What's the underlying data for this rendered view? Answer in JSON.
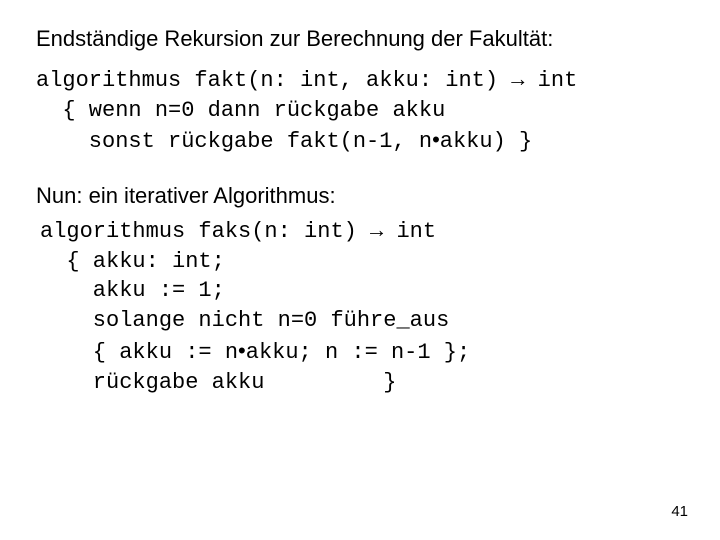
{
  "heading1": "Endständige Rekursion zur Berechnung der Fakultät:",
  "code1_l1": "algorithmus fakt(n: int, akku: int) → int",
  "code1_l2": "  { wenn n=0 dann rückgabe akku",
  "code1_l3_a": "    sonst rückgabe fakt(n-1, n",
  "code1_l3_b": "akku) }",
  "heading2": "Nun: ein iterativer Algorithmus:",
  "code2_l1": "algorithmus faks(n: int) → int",
  "code2_l2": "  { akku: int;",
  "code2_l3": "    akku := 1;",
  "code2_l4": "    solange nicht n=0 führe_aus",
  "code2_l5_a": "    { akku := n",
  "code2_l5_b": "akku; n := n-1 };",
  "code2_l6": "    rückgabe akku         }",
  "dot": "•",
  "pagenum": "41"
}
